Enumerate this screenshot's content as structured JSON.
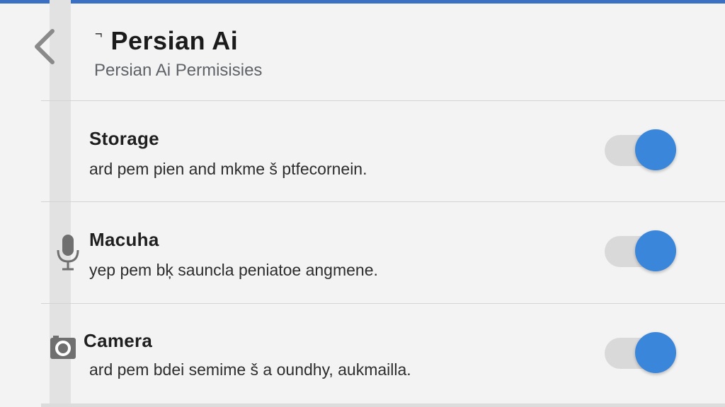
{
  "header": {
    "title_mark": "¬",
    "title": "Persian Ai",
    "subtitle": "Persian Ai Permisisies"
  },
  "colors": {
    "accent": "#3a6fc4",
    "toggle_on": "#3a86db",
    "track": "#d9d9d9"
  },
  "permissions": [
    {
      "title": "Storage",
      "description": "ard pem pien and mkme š ptfecornein.",
      "icon": "none",
      "enabled": true
    },
    {
      "title": "Macuha",
      "description": "yep pem bķ sauncla peniatoe angmene.",
      "icon": "microphone-icon",
      "enabled": true
    },
    {
      "title": "Camera",
      "description": "ard pem bdei semime š a oundhy, aukmailla.",
      "icon": "camera-icon",
      "enabled": true
    }
  ]
}
